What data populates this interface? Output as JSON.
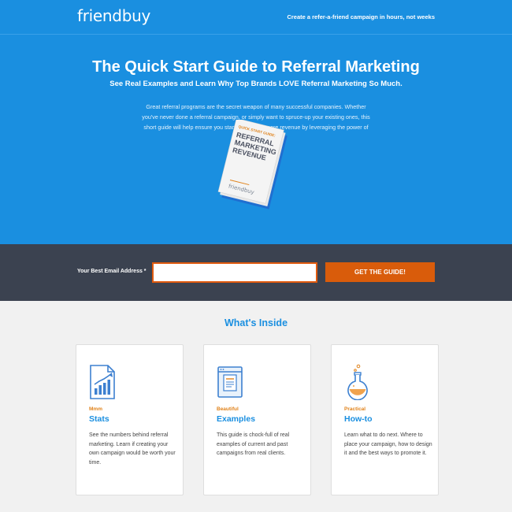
{
  "header": {
    "logo": "friendbuy",
    "tagline": "Create a refer-a-friend campaign in hours, not weeks"
  },
  "hero": {
    "title": "The Quick Start Guide to Referral Marketing",
    "subtitle": "See Real Examples and Learn Why Top Brands LOVE Referral Marketing So Much.",
    "body": "Great referral programs are the secret weapon of many successful companies. Whether you've never done a referral campaign, or simply want to spruce-up your existing ones, this short guide will help ensure you start generating more revenue by leveraging the power of referrals."
  },
  "book": {
    "badge": "QUICK START GUIDE:",
    "line1": "REFERRAL",
    "line2": "MARKETING",
    "line3": "REVENUE",
    "logo": "friendbuy"
  },
  "form": {
    "email_label": "Your Best Email Address *",
    "email_value": "",
    "cta_label": "GET THE GUIDE!"
  },
  "inside": {
    "title": "What's Inside",
    "cards": [
      {
        "kicker": "Mmm",
        "title": "Stats",
        "body": "See the numbers behind referral marketing. Learn if creating your own campaign would be worth your time.",
        "icon": "chart-document-icon"
      },
      {
        "kicker": "Beautiful",
        "title": "Examples",
        "body": "This guide is chock-full of real examples of current and past campaigns from real clients.",
        "icon": "browser-window-icon"
      },
      {
        "kicker": "Practical",
        "title": "How-to",
        "body": "Learn what to do next. Where to place your campaign, how to design it and the best ways to promote it.",
        "icon": "flask-icon"
      }
    ]
  },
  "colors": {
    "brand_blue": "#1a8fe0",
    "dark_band": "#3b4250",
    "cta_orange": "#d95c0b",
    "kicker_orange": "#e0821a"
  }
}
